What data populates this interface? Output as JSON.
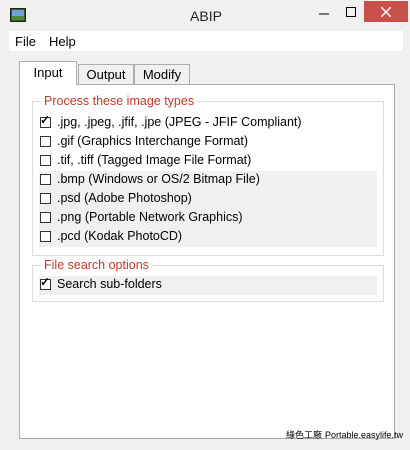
{
  "window": {
    "title": "ABIP"
  },
  "menu": {
    "file": "File",
    "help": "Help"
  },
  "tabs": [
    {
      "label": "Input",
      "active": true
    },
    {
      "label": "Output",
      "active": false
    },
    {
      "label": "Modify",
      "active": false
    }
  ],
  "image_types": {
    "title": "Process these image types",
    "items": [
      {
        "ext": ".jpg, .jpeg, .jfif, .jpe",
        "desc": "(JPEG - JFIF Compliant)",
        "checked": true
      },
      {
        "ext": ".gif",
        "desc": "(Graphics Interchange Format)",
        "checked": false
      },
      {
        "ext": ".tif, .tiff",
        "desc": "(Tagged Image File Format)",
        "checked": false
      },
      {
        "ext": ".bmp",
        "desc": "(Windows or OS/2 Bitmap File)",
        "checked": false
      },
      {
        "ext": ".psd",
        "desc": "(Adobe Photoshop)",
        "checked": false
      },
      {
        "ext": ".png",
        "desc": "(Portable Network Graphics)",
        "checked": false
      },
      {
        "ext": ".pcd",
        "desc": "(Kodak PhotoCD)",
        "checked": false
      }
    ]
  },
  "search_options": {
    "title": "File search options",
    "subfolders_label": "Search sub-folders",
    "subfolders_checked": true
  },
  "watermark": {
    "text": "Portable.easylife.tw",
    "cn": "綠色工廠"
  },
  "colors": {
    "accent": "#c0392b",
    "close": "#c7504b"
  }
}
